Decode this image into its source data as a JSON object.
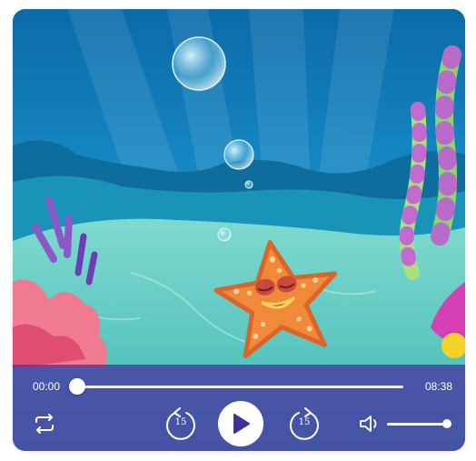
{
  "player": {
    "current_time": "00:00",
    "duration": "08:38",
    "progress_fraction": 0,
    "skip_back_seconds": "15",
    "skip_forward_seconds": "15",
    "volume_fraction": 1,
    "state": "paused"
  },
  "icons": {
    "repeat": "repeat-icon",
    "rewind": "rewind-15-icon",
    "play": "play-icon",
    "forward": "forward-15-icon",
    "volume": "volume-icon"
  },
  "colors": {
    "controls_bar": "#4637a0",
    "play_icon": "#3b3397",
    "water": "#1a7fb3",
    "starfish": "#f08a3a"
  }
}
